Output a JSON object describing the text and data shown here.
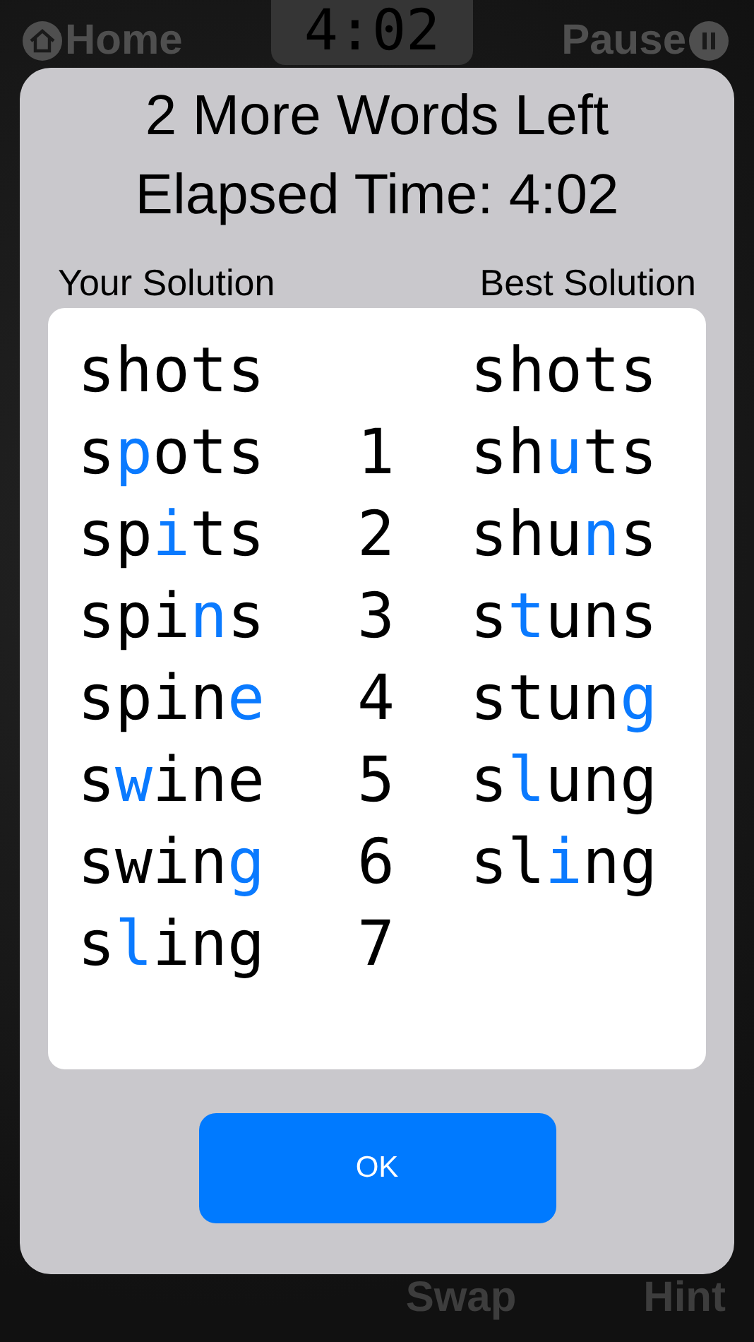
{
  "top_bar": {
    "home": "Home",
    "timer": "4:02",
    "pause": "Pause"
  },
  "bottom_bar": {
    "swap": "Swap",
    "hint": "Hint"
  },
  "dialog": {
    "title_lines": [
      "2 More Words Left",
      "Elapsed Time: 4:02"
    ],
    "your_heading": "Your Solution",
    "best_heading": "Best Solution",
    "your_solution": [
      {
        "before": "shots"
      },
      {
        "before": "s",
        "changed": "p",
        "after": "ots"
      },
      {
        "before": "sp",
        "changed": "i",
        "after": "ts"
      },
      {
        "before": "spi",
        "changed": "n",
        "after": "s"
      },
      {
        "before": "spin",
        "changed": "e"
      },
      {
        "before": "s",
        "changed": "w",
        "after": "ine"
      },
      {
        "before": "swin",
        "changed": "g"
      },
      {
        "before": "s",
        "changed": "l",
        "after": "ing"
      }
    ],
    "step_numbers": [
      "1",
      "2",
      "3",
      "4",
      "5",
      "6",
      "7"
    ],
    "best_solution": [
      {
        "before": "shots"
      },
      {
        "before": "sh",
        "changed": "u",
        "after": "ts"
      },
      {
        "before": "shu",
        "changed": "n",
        "after": "s"
      },
      {
        "before": "s",
        "changed": "t",
        "after": "uns"
      },
      {
        "before": "stun",
        "changed": "g"
      },
      {
        "before": "s",
        "changed": "l",
        "after": "ung"
      },
      {
        "before": "sl",
        "changed": "i",
        "after": "ng"
      }
    ],
    "ok_button": "OK"
  }
}
